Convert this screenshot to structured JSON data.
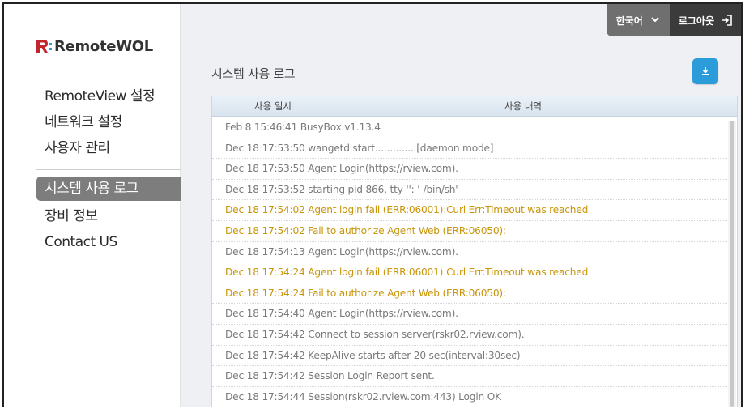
{
  "brand": {
    "prefix": "R:",
    "name": "RemoteWOL"
  },
  "sidebar": {
    "items": [
      {
        "label": "RemoteView 설정"
      },
      {
        "label": "네트워크 설정"
      },
      {
        "label": "사용자 관리"
      },
      {
        "label": "시스템 사용 로그",
        "active": true
      },
      {
        "label": "장비 정보"
      },
      {
        "label": "Contact US"
      }
    ]
  },
  "topbar": {
    "language": "한국어",
    "logout": "로그아웃"
  },
  "page": {
    "title": "시스템 사용 로그"
  },
  "table": {
    "columns": [
      "사용 일시",
      "사용 내역"
    ],
    "rows": [
      {
        "text": "Feb 8 15:46:41 BusyBox v1.13.4",
        "level": "normal"
      },
      {
        "text": "Dec 18 17:53:50 wangetd start..............[daemon mode]",
        "level": "normal"
      },
      {
        "text": "Dec 18 17:53:50 Agent Login(https://rview.com).",
        "level": "normal"
      },
      {
        "text": "Dec 18 17:53:52 starting pid 866, tty '': '-/bin/sh'",
        "level": "normal"
      },
      {
        "text": "Dec 18 17:54:02 Agent login fail (ERR:06001):Curl Err:Timeout was reached",
        "level": "warn"
      },
      {
        "text": "Dec 18 17:54:02 Fail to authorize Agent Web (ERR:06050):",
        "level": "warn"
      },
      {
        "text": "Dec 18 17:54:13 Agent Login(https://rview.com).",
        "level": "normal"
      },
      {
        "text": "Dec 18 17:54:24 Agent login fail (ERR:06001):Curl Err:Timeout was reached",
        "level": "warn"
      },
      {
        "text": "Dec 18 17:54:24 Fail to authorize Agent Web (ERR:06050):",
        "level": "warn"
      },
      {
        "text": "Dec 18 17:54:40 Agent Login(https://rview.com).",
        "level": "normal"
      },
      {
        "text": "Dec 18 17:54:42 Connect to session server(rskr02.rview.com).",
        "level": "normal"
      },
      {
        "text": "Dec 18 17:54:42 KeepAlive starts after 20 sec(interval:30sec)",
        "level": "normal"
      },
      {
        "text": "Dec 18 17:54:42 Session Login Report sent.",
        "level": "normal"
      },
      {
        "text": "Dec 18 17:54:44 Session(rskr02.rview.com:443) Login OK",
        "level": "normal"
      }
    ]
  },
  "colors": {
    "accent": "#2c9bd9",
    "warn": "#c9950a",
    "brand_red": "#c0272d"
  },
  "icons": {
    "download": "download-icon",
    "logout": "logout-icon",
    "chevron": "chevron-down-icon"
  }
}
